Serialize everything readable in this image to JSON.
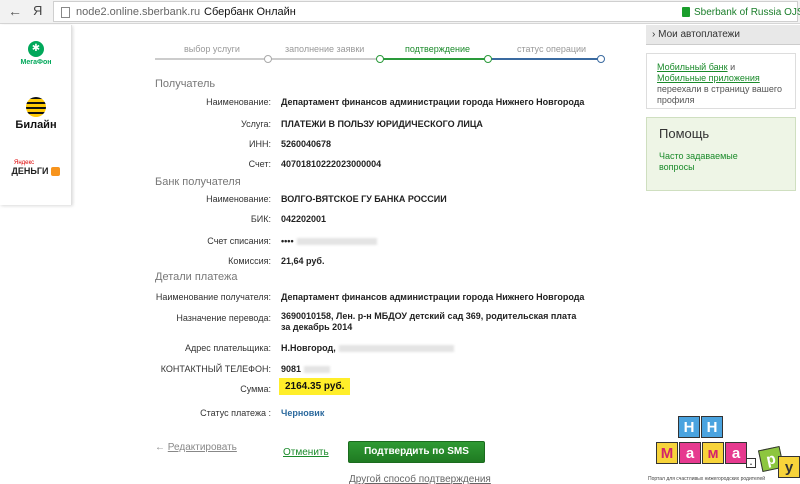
{
  "browser": {
    "ya": "Я",
    "url": "node2.online.sberbank.ru",
    "title": "Сбербанк Онлайн",
    "secure_label": "Sberbank of Russia",
    "secure_cut": "OJSC"
  },
  "ads": {
    "megafon": "МегаФон",
    "beeline": "Билайн",
    "yandex_small": "Яндекс",
    "yandex_money": "ДЕНЬГИ"
  },
  "steps": [
    {
      "label": "выбор услуги"
    },
    {
      "label": "заполнение заявки"
    },
    {
      "label": "подтверждение"
    },
    {
      "label": "статус операции"
    }
  ],
  "recipient": {
    "title": "Получатель",
    "name_label": "Наименование:",
    "name_value": "Департамент финансов администрации города Нижнего Новгорода",
    "service_label": "Услуга:",
    "service_value": "ПЛАТЕЖИ В ПОЛЬЗУ ЮРИДИЧЕСКОГО ЛИЦА",
    "inn_label": "ИНН:",
    "inn_value": "5260040678",
    "account_label": "Счет:",
    "account_value": "40701810222023000004"
  },
  "bank": {
    "title": "Банк получателя",
    "name_label": "Наименование:",
    "name_value": "ВОЛГО-ВЯТСКОЕ ГУ БАНКА РОССИИ",
    "bik_label": "БИК:",
    "bik_value": "042202001",
    "debit_label": "Счет списания:",
    "debit_value": "••••",
    "fee_label": "Комиссия:",
    "fee_value": "21,64 руб."
  },
  "details": {
    "title": "Детали платежа",
    "recipient_label": "Наименование получателя:",
    "recipient_value": "Департамент финансов администрации города Нижнего Новгорода",
    "purpose_label": "Назначение перевода:",
    "purpose_value": "3690010158, Лен. р-н МБДОУ детский сад 369, родительская плата за декабрь 2014",
    "address_label": "Адрес плательщика:",
    "address_value": "Н.Новгород,",
    "phone_label": "КОНТАКТНЫЙ ТЕЛЕФОН:",
    "phone_value": "9081",
    "sum_label": "Сумма:",
    "sum_value": "2164.35 руб.",
    "status_label": "Статус платежа :",
    "status_value": "Черновик"
  },
  "actions": {
    "edit_arrow": "←",
    "edit": "Редактировать",
    "cancel": "Отменить",
    "confirm": "Подтвердить по SMS",
    "other": "Другой способ подтверждения"
  },
  "sidebar": {
    "autopay_arrow": "›",
    "autopay": "Мои автоплатежи",
    "mobile_link1": "Мобильный банк",
    "mobile_and": " и ",
    "mobile_link2": "Мобильные приложения",
    "mobile_rest": " переехали в страницу вашего профиля",
    "help_title": "Помощь",
    "help_link": "Часто задаваемые вопросы"
  },
  "logo": {
    "letters": [
      "Н",
      "Н",
      "М",
      "а",
      "м",
      "а",
      ".",
      "р",
      "у"
    ],
    "caption": "Портал для счастливых нижегородских родителей"
  },
  "colors": {
    "accent_green": "#1a8a2a",
    "highlight_yellow": "#ffee2a",
    "link_blue": "#2c6a9e"
  }
}
